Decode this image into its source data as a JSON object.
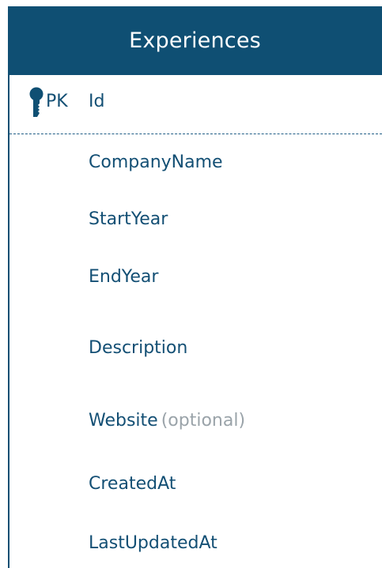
{
  "entity": {
    "title": "Experiences",
    "primary_key": {
      "marker": "PK",
      "name": "Id",
      "icon": "key-icon"
    },
    "fields": [
      {
        "name": "CompanyName"
      },
      {
        "name": "StartYear"
      },
      {
        "name": "EndYear"
      },
      {
        "name": "Description"
      },
      {
        "name": "Website",
        "note": "(optional)"
      },
      {
        "name": "CreatedAt"
      },
      {
        "name": "LastUpdatedAt"
      }
    ],
    "colors": {
      "header": "#0f4f73",
      "text": "#134f74",
      "muted": "#9aa3a9"
    }
  }
}
